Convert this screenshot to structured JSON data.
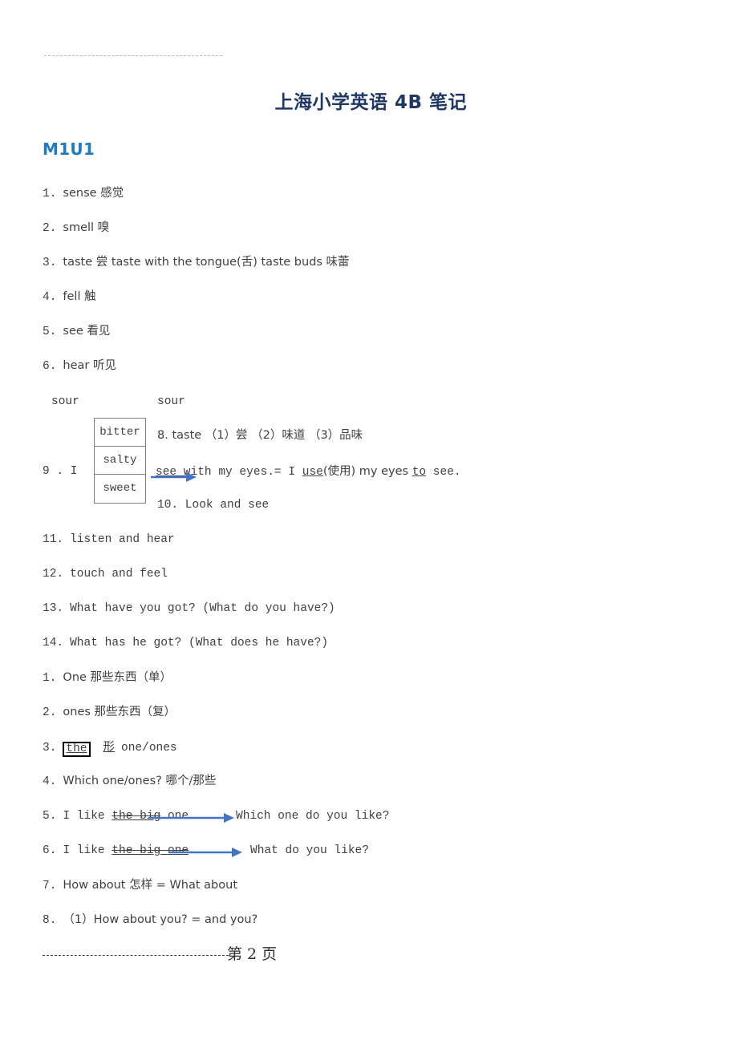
{
  "document": {
    "title": "上海小学英语 4B 笔记",
    "section_heading": "M1U1",
    "title_color": "#1F3864",
    "heading_color": "#1F7AC4",
    "arrow_color": "#4472C4"
  },
  "vocab_list": {
    "items": [
      {
        "num": "1.",
        "text": "sense 感觉"
      },
      {
        "num": "2.",
        "text": "smell  嗅"
      },
      {
        "num": "3.",
        "text": "taste 尝   taste  with  the  tongue(舌)   taste  buds 味蕾"
      },
      {
        "num": "4.",
        "text": "fell    触"
      },
      {
        "num": "5.",
        "text": "see    看见"
      },
      {
        "num": "6.",
        "text": "hear   听见"
      }
    ]
  },
  "flavour_table": {
    "cells": [
      "bitter",
      "salty",
      "sweet"
    ],
    "label_left": "sour",
    "label_right": "sour"
  },
  "mid_items": {
    "item8": "8. taste   （1）尝   （2）味道   （3）品味",
    "item9_prefix": "9 . I",
    "item9_seg1": "see w",
    "item9_seg2": "ith my eyes.= I ",
    "item9_seg3": "use",
    "item9_seg4": "(使用) my eyes ",
    "item9_seg5": "to",
    "item9_seg6": " see.",
    "item10": "10. Look and see"
  },
  "lower_list": {
    "items": [
      {
        "num": "11.",
        "text": "listen and hear"
      },
      {
        "num": "12.",
        "text": "touch and feel"
      },
      {
        "num": "13.",
        "text": "What have you got? (What do you have?)"
      },
      {
        "num": "14.",
        "text": "What has he got? (What does he have?)"
      }
    ]
  },
  "second_list": {
    "item1": {
      "num": "1.",
      "text": "One  那些东西（单）"
    },
    "item2": {
      "num": "2.",
      "text": "ones 那些东西（复）"
    },
    "item3": {
      "num": "3.",
      "boxed": "the",
      "underlined_cn": "形",
      "tail": "one/ones"
    },
    "item4": {
      "num": "4.",
      "text": "Which one/ones?  哪个/那些"
    },
    "item5": {
      "num": "5.",
      "lead": "I like ",
      "struck": "the big",
      "mid": " one.",
      "after": "Which one do you like?"
    },
    "item6": {
      "num": "6.",
      "lead": "I like ",
      "struck": "the big one",
      "mid": ".",
      "after": "What do you like?"
    },
    "item7": {
      "num": "7.",
      "text": "How about 怎样 = What about"
    },
    "item8": {
      "num": "8.",
      "text": "（1）How about you? = and you?"
    }
  },
  "footer": {
    "page_label": "第 2 页"
  }
}
